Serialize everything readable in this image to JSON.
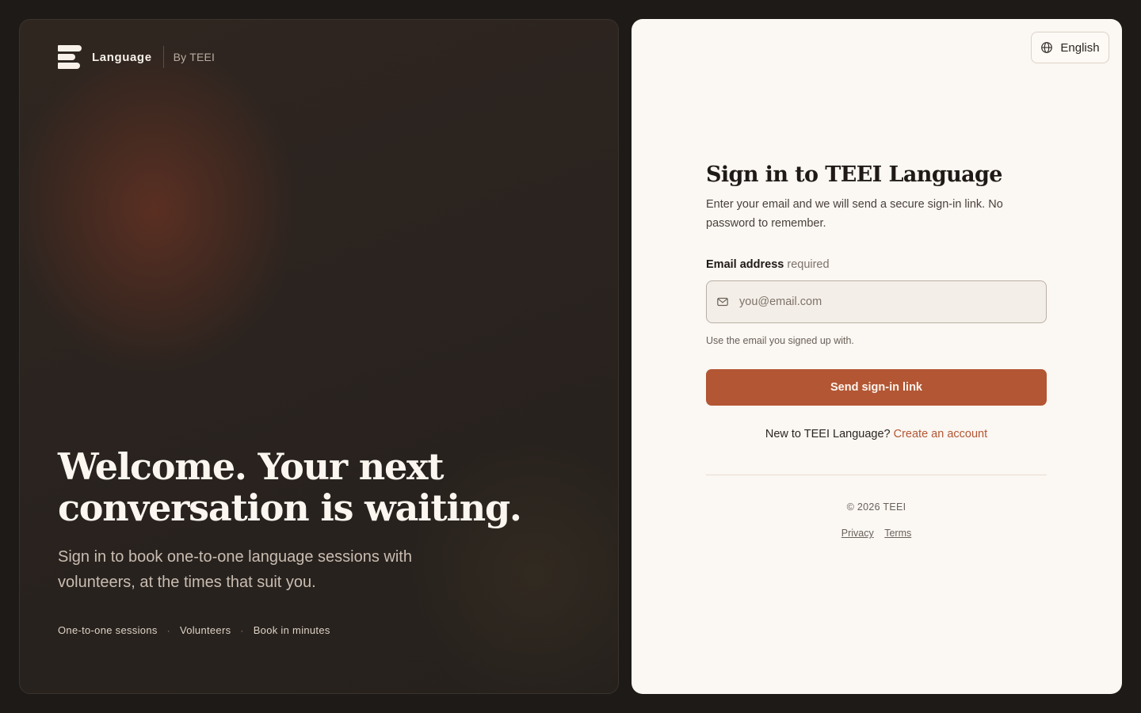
{
  "brand": {
    "name": "Language",
    "by": "By TEEI"
  },
  "hero": {
    "headline_line1": "Welcome. Your next",
    "headline_line2": "conversation is waiting.",
    "subtitle": "Sign in to book one-to-one language sessions with volunteers, at the times that suit you.",
    "chips": [
      "One-to-one sessions",
      "Volunteers",
      "Book in minutes"
    ],
    "chip_separator": "·"
  },
  "language_selector": {
    "label": "English",
    "icon": "globe-icon"
  },
  "form": {
    "title": "Sign in to TEEI Language",
    "subtitle": "Enter your email and we will send a secure sign-in link. No password to remember.",
    "email_label": "Email address",
    "email_required": "required",
    "email_placeholder": "you@email.com",
    "email_value": "",
    "email_icon": "mail-icon",
    "hint": "Use the email you signed up with.",
    "submit_label": "Send sign-in link",
    "new_account_prompt": "New to TEEI Language?",
    "create_account_label": "Create an account"
  },
  "footer": {
    "copyright": "© 2026 TEEI",
    "privacy_label": "Privacy",
    "terms_label": "Terms"
  },
  "colors": {
    "accent": "#b35634",
    "page_background": "#1e1a17",
    "card_background": "#fbf7f2"
  }
}
